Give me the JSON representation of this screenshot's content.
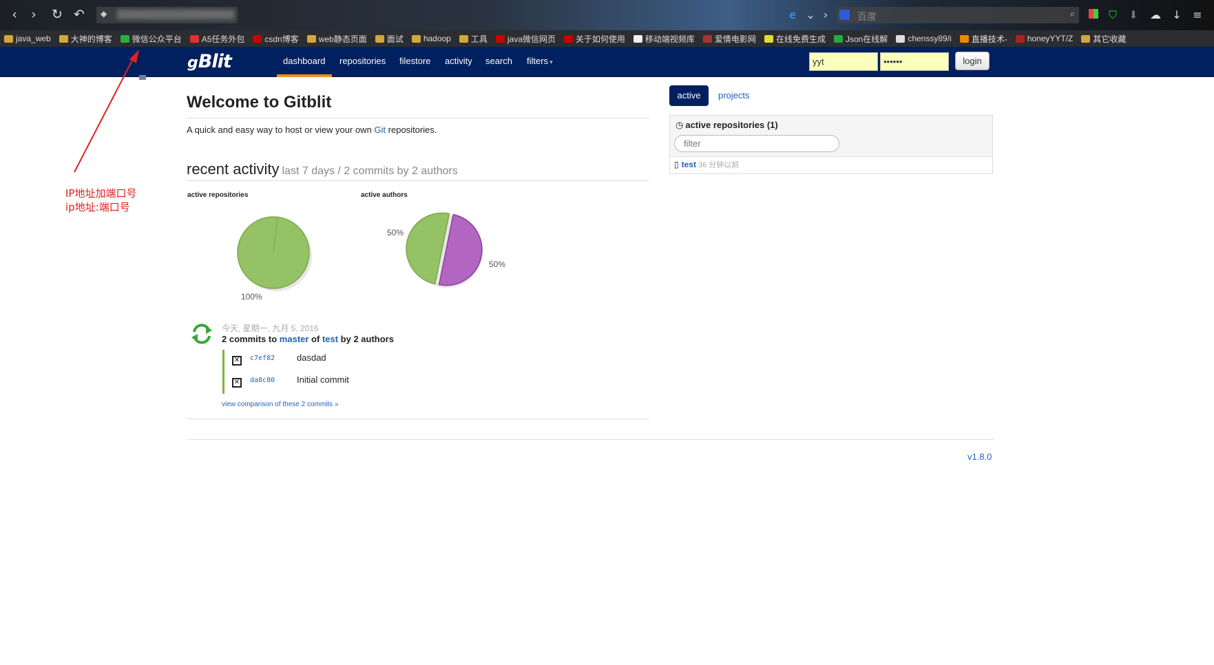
{
  "browser": {
    "search_placeholder": "百度",
    "bookmarks": [
      {
        "label": "java_web",
        "color": "#d4a73c"
      },
      {
        "label": "大神的博客",
        "color": "#d4a73c"
      },
      {
        "label": "微信公众平台",
        "color": "#2aae3e"
      },
      {
        "label": "A5任务外包",
        "color": "#d33"
      },
      {
        "label": "csdn博客",
        "color": "#c00"
      },
      {
        "label": "web静态页面",
        "color": "#d4a73c"
      },
      {
        "label": "面试",
        "color": "#d4a73c"
      },
      {
        "label": "hadoop",
        "color": "#d4a73c"
      },
      {
        "label": "工具",
        "color": "#d4a73c"
      },
      {
        "label": "java微信网页",
        "color": "#c00"
      },
      {
        "label": "关于如何使用",
        "color": "#c00"
      },
      {
        "label": "移动端视频库",
        "color": "#eee"
      },
      {
        "label": "爱情电影网",
        "color": "#a33"
      },
      {
        "label": "在线免费生成",
        "color": "#dd3"
      },
      {
        "label": "Json在线解",
        "color": "#2a4"
      },
      {
        "label": "chenssy89/i",
        "color": "#ddd"
      },
      {
        "label": "直播技术-",
        "color": "#e80"
      },
      {
        "label": "honeyYYT/Z",
        "color": "#a22"
      },
      {
        "label": "其它收藏",
        "color": "#d4a73c"
      }
    ]
  },
  "navbar": {
    "logo": "Blit",
    "logo_prefix": "g",
    "links": [
      "dashboard",
      "repositories",
      "filestore",
      "activity",
      "search",
      "filters"
    ],
    "username_value": "yyt",
    "password_value": "••••••",
    "login_label": "login"
  },
  "main": {
    "title": "Welcome to Gitblit",
    "intro_before": "A quick and easy way to host or view your own ",
    "intro_link": "Git",
    "intro_after": " repositories.",
    "recent_title": "recent activity",
    "recent_sub": "last 7 days / 2 commits by 2 authors"
  },
  "charts": {
    "repos_title": "active repositories",
    "authors_title": "active authors"
  },
  "chart_data": [
    {
      "type": "pie",
      "title": "active repositories",
      "slices": [
        {
          "value": 100,
          "label": "100%",
          "color": "#94c264"
        }
      ]
    },
    {
      "type": "pie",
      "title": "active authors",
      "slices": [
        {
          "value": 50,
          "label": "50%",
          "color": "#b266c2"
        },
        {
          "value": 50,
          "label": "50%",
          "color": "#94c264"
        }
      ]
    }
  ],
  "activity": {
    "date": "今天, 星期一, 九月 5, 2016",
    "summary_a": "2 commits to ",
    "branch": "master",
    "summary_b": " of ",
    "repo": "test",
    "summary_c": " by 2 authors",
    "commits": [
      {
        "hash": "c7ef82",
        "message": "dasdad"
      },
      {
        "hash": "da8c80",
        "message": "Initial commit"
      }
    ],
    "compare_link": "view comparison of these 2 commits »"
  },
  "sidebar": {
    "tab_active": "active",
    "tab_projects": "projects",
    "panel_title": "active repositories (1)",
    "filter_placeholder": "filter",
    "repo_name": "test",
    "repo_time": "36 分钟以前"
  },
  "footer": {
    "version": "v1.8.0"
  },
  "annotation": {
    "line1": "IP地址加端口号",
    "line2": "ip地址:端口号",
    "color": "#e02020"
  }
}
